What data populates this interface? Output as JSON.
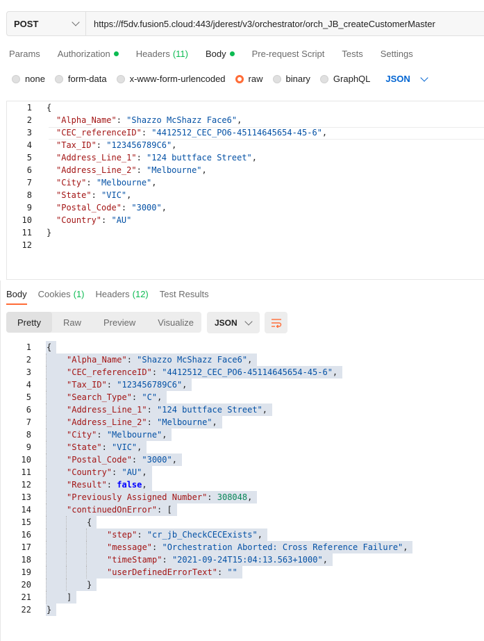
{
  "request": {
    "method": "POST",
    "url": "https://f5dv.fusion5.cloud:443/jderest/v3/orchestrator/orch_JB_createCustomerMaster"
  },
  "request_tabs": [
    {
      "label": "Params",
      "dot": false,
      "count": ""
    },
    {
      "label": "Authorization",
      "dot": true,
      "count": ""
    },
    {
      "label": "Headers",
      "dot": false,
      "count": "(11)"
    },
    {
      "label": "Body",
      "dot": true,
      "count": "",
      "active": true
    },
    {
      "label": "Pre-request Script",
      "dot": false,
      "count": ""
    },
    {
      "label": "Tests",
      "dot": false,
      "count": ""
    },
    {
      "label": "Settings",
      "dot": false,
      "count": ""
    }
  ],
  "body_types": [
    {
      "label": "none",
      "selected": false
    },
    {
      "label": "form-data",
      "selected": false
    },
    {
      "label": "x-www-form-urlencoded",
      "selected": false
    },
    {
      "label": "raw",
      "selected": true
    },
    {
      "label": "binary",
      "selected": false
    },
    {
      "label": "GraphQL",
      "selected": false
    }
  ],
  "body_language": "JSON",
  "request_body_lines": [
    [
      [
        "punct",
        "{"
      ]
    ],
    [
      [
        "key",
        "\"Alpha_Name\""
      ],
      [
        "punct",
        ": "
      ],
      [
        "str",
        "\"Shazzo McShazz Face6\""
      ],
      [
        "punct",
        ","
      ]
    ],
    [
      [
        "key",
        "\"CEC_referenceID\""
      ],
      [
        "punct",
        ": "
      ],
      [
        "str",
        "\"4412512_CEC_PO6-45114645654-45-6\""
      ],
      [
        "punct",
        ","
      ]
    ],
    [
      [
        "key",
        "\"Tax_ID\""
      ],
      [
        "punct",
        ": "
      ],
      [
        "str",
        "\"123456789C6\""
      ],
      [
        "punct",
        ","
      ]
    ],
    [
      [
        "key",
        "\"Address_Line_1\""
      ],
      [
        "punct",
        ": "
      ],
      [
        "str",
        "\"124 buttface Street\""
      ],
      [
        "punct",
        ","
      ]
    ],
    [
      [
        "key",
        "\"Address_Line_2\""
      ],
      [
        "punct",
        ": "
      ],
      [
        "str",
        "\"Melbourne\""
      ],
      [
        "punct",
        ","
      ]
    ],
    [
      [
        "key",
        "\"City\""
      ],
      [
        "punct",
        ": "
      ],
      [
        "str",
        "\"Melbourne\""
      ],
      [
        "punct",
        ","
      ]
    ],
    [
      [
        "key",
        "\"State\""
      ],
      [
        "punct",
        ": "
      ],
      [
        "str",
        "\"VIC\""
      ],
      [
        "punct",
        ","
      ]
    ],
    [
      [
        "key",
        "\"Postal_Code\""
      ],
      [
        "punct",
        ": "
      ],
      [
        "str",
        "\"3000\""
      ],
      [
        "punct",
        ","
      ]
    ],
    [
      [
        "key",
        "\"Country\""
      ],
      [
        "punct",
        ": "
      ],
      [
        "str",
        "\"AU\""
      ]
    ],
    [
      [
        "punct",
        "}"
      ]
    ],
    []
  ],
  "response_tabs": [
    {
      "label": "Body",
      "count": "",
      "active": true
    },
    {
      "label": "Cookies",
      "count": "(1)"
    },
    {
      "label": "Headers",
      "count": "(12)"
    },
    {
      "label": "Test Results",
      "count": ""
    }
  ],
  "response_views": [
    {
      "label": "Pretty",
      "active": true
    },
    {
      "label": "Raw",
      "active": false
    },
    {
      "label": "Preview",
      "active": false
    },
    {
      "label": "Visualize",
      "active": false
    }
  ],
  "response_format": "JSON",
  "response_body_lines": [
    {
      "indent": 0,
      "tokens": [
        [
          "punct",
          "{"
        ]
      ]
    },
    {
      "indent": 1,
      "tokens": [
        [
          "key",
          "\"Alpha_Name\""
        ],
        [
          "punct",
          ": "
        ],
        [
          "str",
          "\"Shazzo McShazz Face6\""
        ],
        [
          "punct",
          ","
        ]
      ]
    },
    {
      "indent": 1,
      "tokens": [
        [
          "key",
          "\"CEC_referenceID\""
        ],
        [
          "punct",
          ": "
        ],
        [
          "str",
          "\"4412512_CEC_PO6-45114645654-45-6\""
        ],
        [
          "punct",
          ","
        ]
      ]
    },
    {
      "indent": 1,
      "tokens": [
        [
          "key",
          "\"Tax_ID\""
        ],
        [
          "punct",
          ": "
        ],
        [
          "str",
          "\"123456789C6\""
        ],
        [
          "punct",
          ","
        ]
      ]
    },
    {
      "indent": 1,
      "tokens": [
        [
          "key",
          "\"Search_Type\""
        ],
        [
          "punct",
          ": "
        ],
        [
          "str",
          "\"C\""
        ],
        [
          "punct",
          ","
        ]
      ]
    },
    {
      "indent": 1,
      "tokens": [
        [
          "key",
          "\"Address_Line_1\""
        ],
        [
          "punct",
          ": "
        ],
        [
          "str",
          "\"124 buttface Street\""
        ],
        [
          "punct",
          ","
        ]
      ]
    },
    {
      "indent": 1,
      "tokens": [
        [
          "key",
          "\"Address_Line_2\""
        ],
        [
          "punct",
          ": "
        ],
        [
          "str",
          "\"Melbourne\""
        ],
        [
          "punct",
          ","
        ]
      ]
    },
    {
      "indent": 1,
      "tokens": [
        [
          "key",
          "\"City\""
        ],
        [
          "punct",
          ": "
        ],
        [
          "str",
          "\"Melbourne\""
        ],
        [
          "punct",
          ","
        ]
      ]
    },
    {
      "indent": 1,
      "tokens": [
        [
          "key",
          "\"State\""
        ],
        [
          "punct",
          ": "
        ],
        [
          "str",
          "\"VIC\""
        ],
        [
          "punct",
          ","
        ]
      ]
    },
    {
      "indent": 1,
      "tokens": [
        [
          "key",
          "\"Postal_Code\""
        ],
        [
          "punct",
          ": "
        ],
        [
          "str",
          "\"3000\""
        ],
        [
          "punct",
          ","
        ]
      ]
    },
    {
      "indent": 1,
      "tokens": [
        [
          "key",
          "\"Country\""
        ],
        [
          "punct",
          ": "
        ],
        [
          "str",
          "\"AU\""
        ],
        [
          "punct",
          ","
        ]
      ]
    },
    {
      "indent": 1,
      "tokens": [
        [
          "key",
          "\"Result\""
        ],
        [
          "punct",
          ": "
        ],
        [
          "bool",
          "false"
        ],
        [
          "punct",
          ","
        ]
      ]
    },
    {
      "indent": 1,
      "tokens": [
        [
          "key",
          "\"Previously Assigned Number\""
        ],
        [
          "punct",
          ": "
        ],
        [
          "num",
          "308048"
        ],
        [
          "punct",
          ","
        ]
      ]
    },
    {
      "indent": 1,
      "tokens": [
        [
          "key",
          "\"continuedOnError\""
        ],
        [
          "punct",
          ": ["
        ]
      ]
    },
    {
      "indent": 2,
      "tokens": [
        [
          "punct",
          "{"
        ]
      ]
    },
    {
      "indent": 3,
      "tokens": [
        [
          "key",
          "\"step\""
        ],
        [
          "punct",
          ": "
        ],
        [
          "str",
          "\"cr_jb_CheckCECExists\""
        ],
        [
          "punct",
          ","
        ]
      ]
    },
    {
      "indent": 3,
      "tokens": [
        [
          "key",
          "\"message\""
        ],
        [
          "punct",
          ": "
        ],
        [
          "str",
          "\"Orchestration Aborted: Cross Reference Failure\""
        ],
        [
          "punct",
          ","
        ]
      ]
    },
    {
      "indent": 3,
      "tokens": [
        [
          "key",
          "\"timeStamp\""
        ],
        [
          "punct",
          ": "
        ],
        [
          "str",
          "\"2021-09-24T15:04:13.563+1000\""
        ],
        [
          "punct",
          ","
        ]
      ]
    },
    {
      "indent": 3,
      "tokens": [
        [
          "key",
          "\"userDefinedErrorText\""
        ],
        [
          "punct",
          ": "
        ],
        [
          "str",
          "\"\""
        ]
      ]
    },
    {
      "indent": 2,
      "tokens": [
        [
          "punct",
          "}"
        ]
      ]
    },
    {
      "indent": 1,
      "tokens": [
        [
          "punct",
          "]"
        ]
      ]
    },
    {
      "indent": 0,
      "tokens": [
        [
          "punct",
          "}"
        ]
      ]
    }
  ]
}
